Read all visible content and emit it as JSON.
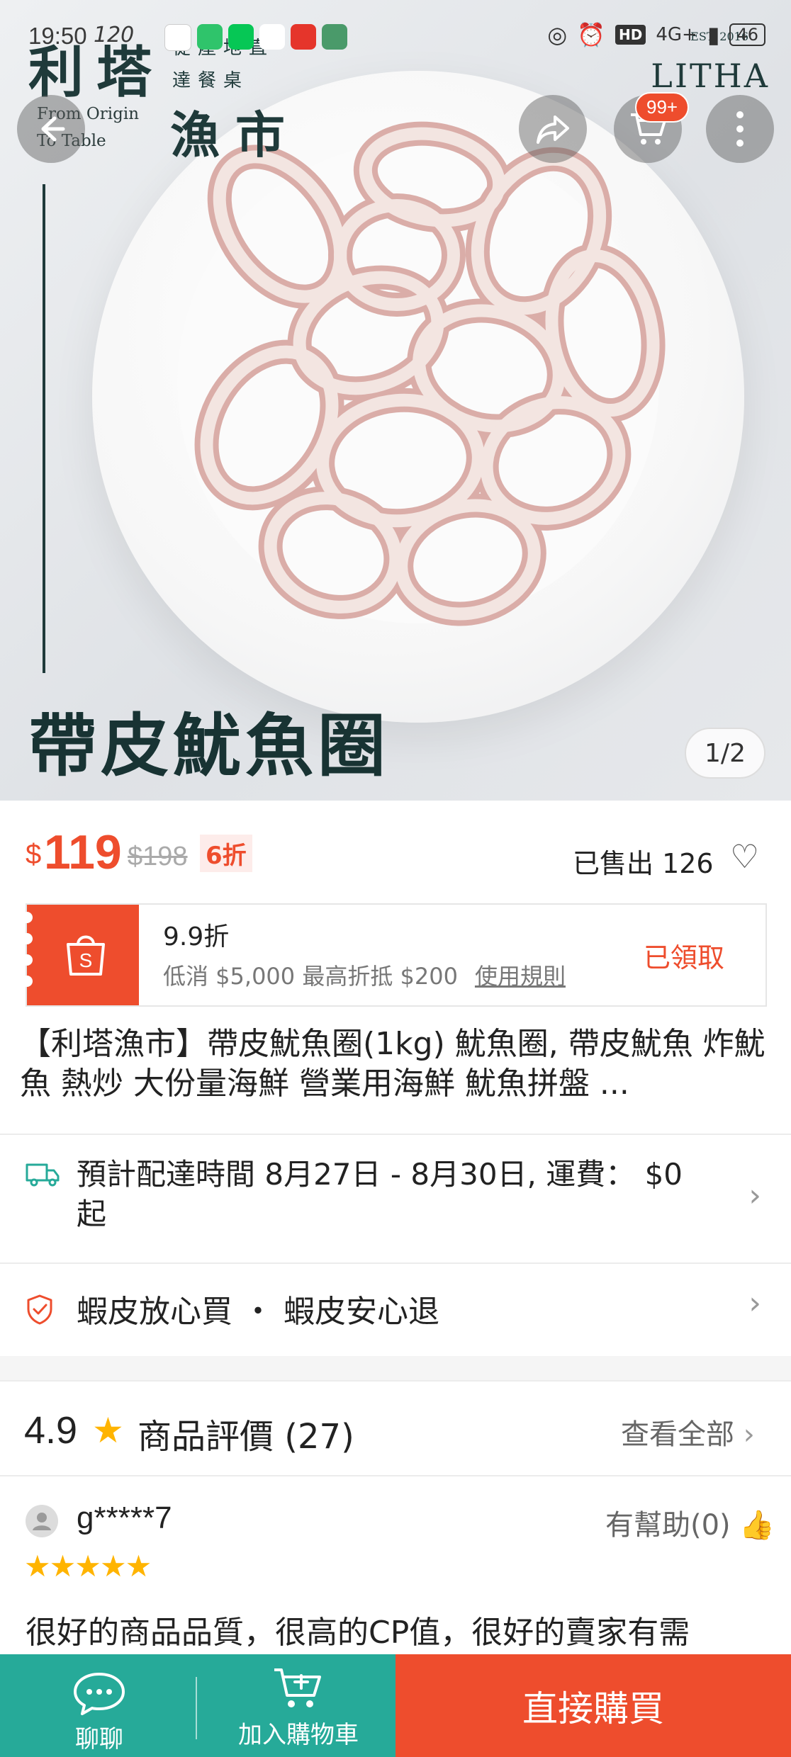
{
  "status_bar": {
    "time": "19:50",
    "refresh": "120",
    "network": "4G+",
    "hd": "HD",
    "battery": "46"
  },
  "hero": {
    "brand_cn_1": "利塔",
    "brand_cn_2": "漁市",
    "brand_slogan": "從產地直達餐桌",
    "brand_en": "From Origin To Table",
    "brand_logo": "LITHA",
    "brand_logo_sub": "EST. 2016",
    "product_caption": "帶皮魷魚圈",
    "cart_badge": "99+",
    "image_counter": "1/2"
  },
  "price": {
    "currency": "$",
    "current": "119",
    "original": "$198",
    "discount": "6折",
    "sold": "已售出 126"
  },
  "voucher": {
    "title": "9.9折",
    "desc": "低消 $5,000 最高折抵 $200",
    "rule_link": "使用規則",
    "status": "已領取"
  },
  "product_title": "【利塔漁市】帶皮魷魚圈(1kg) 魷魚圈, 帶皮魷魚 炸魷魚 熱炒 大份量海鮮 營業用海鮮 魷魚拼盤 ...",
  "shipping": {
    "text": "預計配達時間 8月27日 - 8月30日, 運費： $0 起"
  },
  "guarantee": {
    "text": "蝦皮放心買 ・ 蝦皮安心退"
  },
  "reviews": {
    "score": "4.9",
    "label": "商品評價",
    "count": "(27)",
    "view_all": "查看全部",
    "item": {
      "user": "g*****7",
      "helpful": "有幫助(0)",
      "rating": 5,
      "stars": "★★★★★",
      "text": "很好的商品品質，很高的CP值，很好的賣家有需"
    }
  },
  "bottom_bar": {
    "chat_label": "聊聊",
    "cart_label": "加入購物車",
    "buy_label": "直接購買"
  },
  "colors": {
    "accent": "#ee4d2d",
    "teal": "#26aa99",
    "star": "#ffb400"
  }
}
